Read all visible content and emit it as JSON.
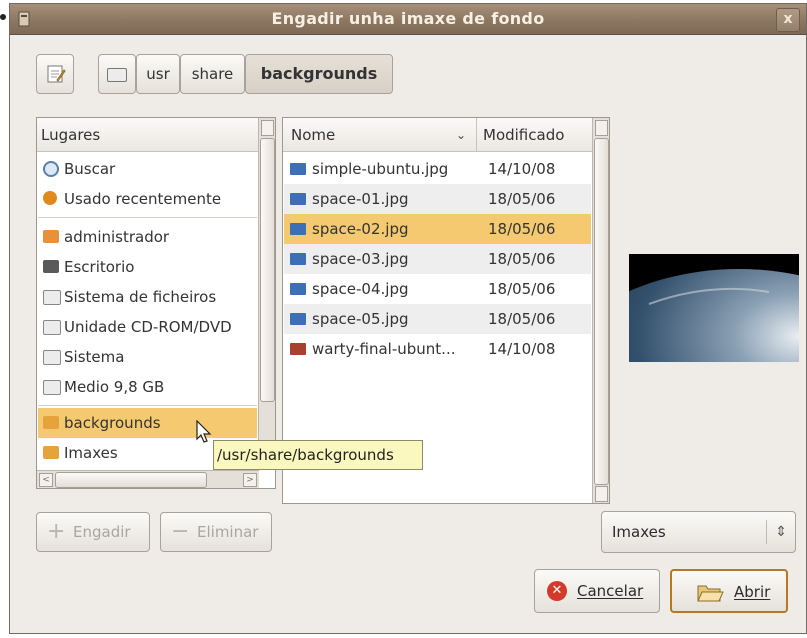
{
  "window": {
    "title": "Engadir unha imaxe de fondo",
    "close": "x"
  },
  "breadcrumb": {
    "items": [
      "usr",
      "share",
      "backgrounds"
    ]
  },
  "places": {
    "header": "Lugares",
    "items": [
      {
        "label": "Buscar",
        "icon": "search-icon"
      },
      {
        "label": "Usado recentemente",
        "icon": "recent-icon"
      },
      {
        "label": "administrador",
        "icon": "home-folder-icon"
      },
      {
        "label": "Escritorio",
        "icon": "desktop-icon"
      },
      {
        "label": "Sistema de ficheiros",
        "icon": "drive-icon"
      },
      {
        "label": "Unidade CD-ROM/DVD",
        "icon": "cdrom-icon"
      },
      {
        "label": "Sistema",
        "icon": "drive-icon"
      },
      {
        "label": "Medio 9,8 GB",
        "icon": "drive-icon"
      },
      {
        "label": "backgrounds",
        "icon": "folder-icon"
      },
      {
        "label": "Imaxes",
        "icon": "folder-icon"
      }
    ],
    "selected": "backgrounds"
  },
  "files": {
    "col_name": "Nome",
    "col_modified": "Modificado",
    "rows": [
      {
        "name": "simple-ubuntu.jpg",
        "date": "14/10/08"
      },
      {
        "name": "space-01.jpg",
        "date": "18/05/06"
      },
      {
        "name": "space-02.jpg",
        "date": "18/05/06"
      },
      {
        "name": "space-03.jpg",
        "date": "18/05/06"
      },
      {
        "name": "space-04.jpg",
        "date": "18/05/06"
      },
      {
        "name": "space-05.jpg",
        "date": "18/05/06"
      },
      {
        "name": "warty-final-ubunt...",
        "date": "14/10/08"
      }
    ],
    "selected": "space-02.jpg"
  },
  "tooltip": "/usr/share/backgrounds",
  "buttons": {
    "add": "Engadir",
    "remove": "Eliminar",
    "cancel": "Cancelar",
    "open": "Abrir"
  },
  "filter": {
    "selected": "Imaxes"
  },
  "colors": {
    "selection": "#f5c96f",
    "titlebar": "#8c7762",
    "tooltip": "#fbf8bf"
  }
}
